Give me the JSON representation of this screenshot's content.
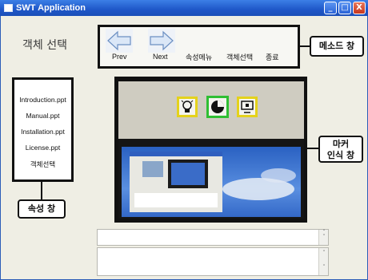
{
  "window": {
    "title": "SWT Application",
    "minimize_icon": "_",
    "maximize_icon": "□",
    "close_icon": "X"
  },
  "select_label": "객체 선택",
  "method_panel": {
    "prev_label": "Prev",
    "next_label": "Next",
    "menu_items": [
      "속성메뉴",
      "객체선택",
      "종료"
    ]
  },
  "property_panel": {
    "items": [
      "Introduction.ppt",
      "Manual.ppt",
      "Installation.ppt",
      "License.ppt",
      "객체선택"
    ]
  },
  "callouts": {
    "method_window": "메소드 창",
    "marker_window_line1": "마커",
    "marker_window_line2": "인식 창",
    "property_window": "속성 창"
  },
  "markers": [
    {
      "icon": "lightbulb-icon",
      "color": "#e4d21c"
    },
    {
      "icon": "pie-chart-icon",
      "color": "#2fbf33"
    },
    {
      "icon": "projector-icon",
      "color": "#e4d21c"
    }
  ],
  "text_areas": [
    {
      "value": ""
    },
    {
      "value": ""
    }
  ],
  "colors": {
    "titlebar": "#1f57c8",
    "window_bg": "#efeee4",
    "annotation": "#111111"
  }
}
